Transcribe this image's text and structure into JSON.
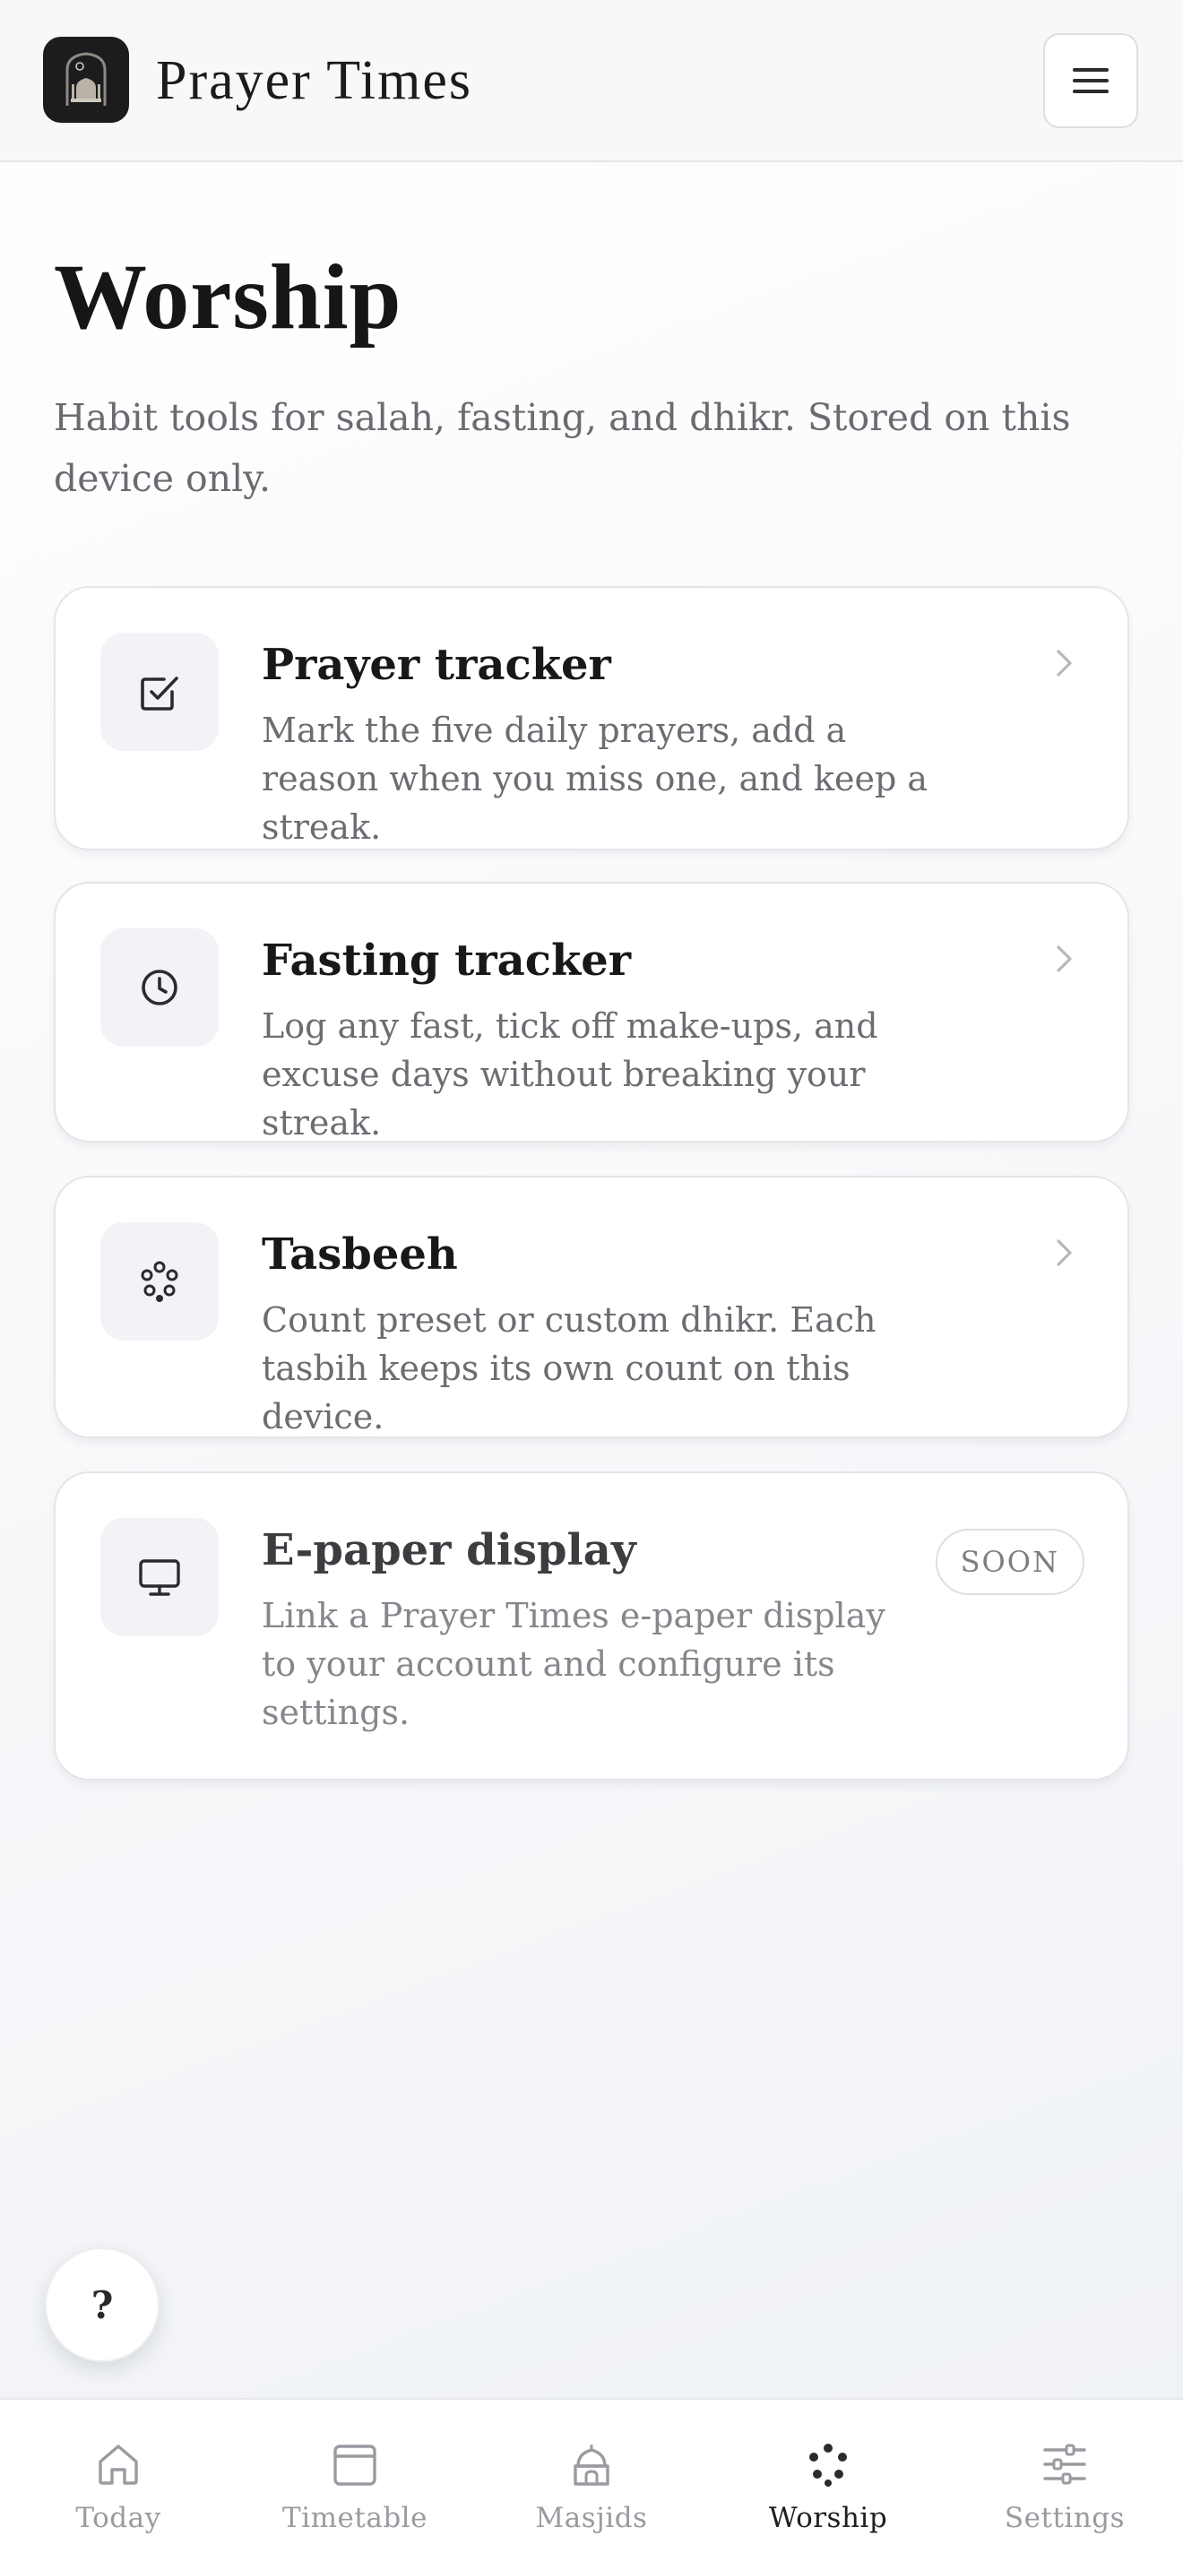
{
  "header": {
    "app_title": "Prayer Times",
    "logo_icon": "mosque-logo-icon",
    "menu_icon": "hamburger-menu-icon"
  },
  "page": {
    "title": "Worship",
    "subtitle": "Habit tools for salah, fasting, and dhikr. Stored on this device only."
  },
  "cards": [
    {
      "title": "Prayer tracker",
      "description": "Mark the five daily prayers, add a reason when you miss one, and keep a streak.",
      "icon": "checkbox-icon"
    },
    {
      "title": "Fasting tracker",
      "description": "Log any fast, tick off make-ups, and excuse days without breaking your streak.",
      "icon": "clock-icon"
    },
    {
      "title": "Tasbeeh",
      "description": "Count preset or custom dhikr. Each tasbih keeps its own count on this device.",
      "icon": "prayer-beads-icon"
    },
    {
      "title": "E-paper display",
      "description": "Link a Prayer Times e-paper display to your account and configure its settings.",
      "icon": "monitor-icon",
      "badge": "SOON"
    }
  ],
  "help": {
    "label": "?"
  },
  "bottom_nav": {
    "active": "Worship",
    "items": [
      {
        "label": "Today",
        "icon": "home-icon"
      },
      {
        "label": "Timetable",
        "icon": "calendar-icon"
      },
      {
        "label": "Masjids",
        "icon": "mosque-icon"
      },
      {
        "label": "Worship",
        "icon": "prayer-beads-icon"
      },
      {
        "label": "Settings",
        "icon": "sliders-icon"
      }
    ]
  },
  "colors": {
    "text_primary": "#18181a",
    "text_muted": "#6c6d72",
    "nav_inactive": "#9a9ba0",
    "card_background": "#ffffff",
    "icon_tile": "#f1f3f6",
    "logo_background": "#1c1c1e"
  }
}
